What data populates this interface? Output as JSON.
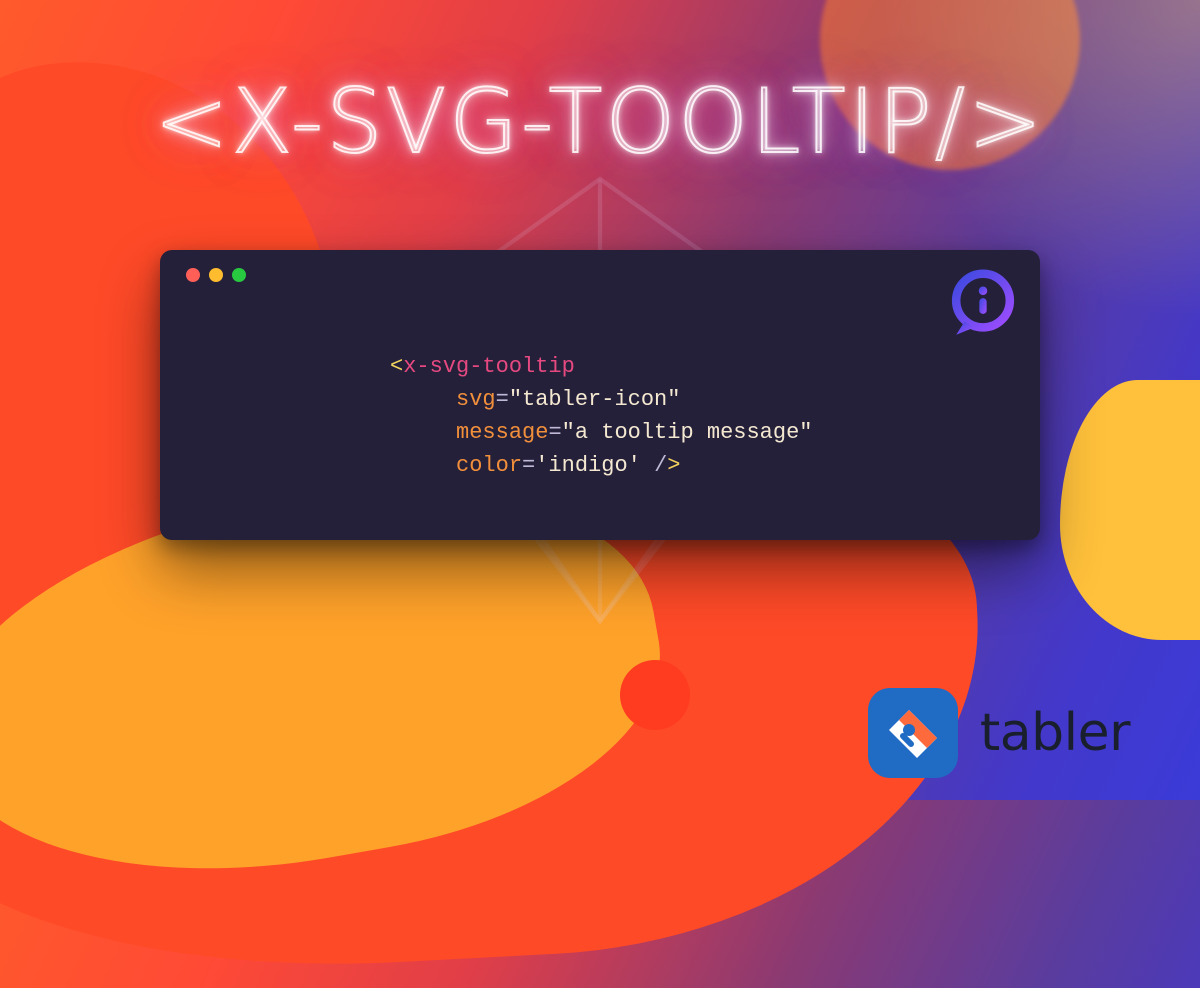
{
  "title": "<X-SVG-TOOLTIP/>",
  "code": {
    "tag": "x-svg-tooltip",
    "attrs": [
      {
        "name": "svg",
        "value": "\"tabler-icon\""
      },
      {
        "name": "message",
        "value": "\"a tooltip message\""
      },
      {
        "name": "color",
        "value": "'indigo'"
      }
    ]
  },
  "brand": {
    "name": "tabler"
  },
  "colors": {
    "card_bg": "#24203a",
    "dot_red": "#ff5f57",
    "dot_yellow": "#febc2e",
    "dot_green": "#28c840",
    "brand_blue": "#206bc4"
  },
  "icons": {
    "info_bubble": "info-bubble-icon",
    "pen": "pen-icon"
  }
}
